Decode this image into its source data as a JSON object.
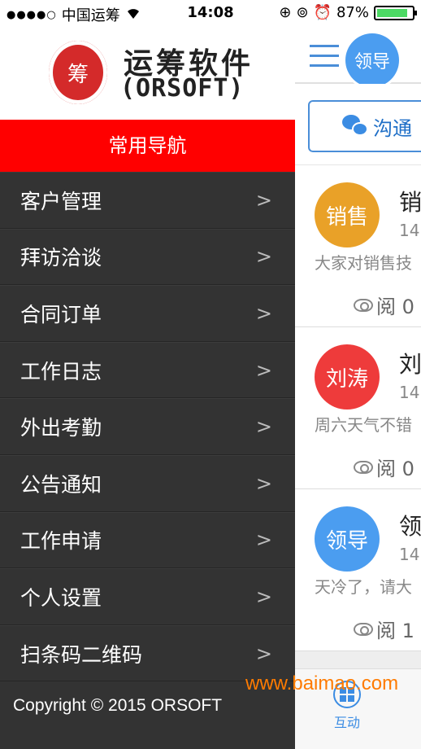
{
  "status_bar": {
    "signal": "●●●●○",
    "carrier": "中国运筹",
    "wifi_icon": "wifi-icon",
    "time": "14:08",
    "battery_percent": "87%",
    "battery_level": 0.87
  },
  "brand": {
    "seal_text": "筹",
    "name": "运筹软件",
    "sub": "(ORSOFT)"
  },
  "menu": {
    "header": "常用导航",
    "items": [
      {
        "label": "客户管理",
        "chevron": ">"
      },
      {
        "label": "拜访洽谈",
        "chevron": ">"
      },
      {
        "label": "合同订单",
        "chevron": ">"
      },
      {
        "label": "工作日志",
        "chevron": ">"
      },
      {
        "label": "外出考勤",
        "chevron": ">"
      },
      {
        "label": "公告通知",
        "chevron": ">"
      },
      {
        "label": "工作申请",
        "chevron": ">"
      },
      {
        "label": "个人设置",
        "chevron": ">"
      },
      {
        "label": "扫条码二维码",
        "chevron": ">"
      }
    ],
    "copyright": "Copyright © 2015 ORSOFT"
  },
  "content": {
    "top_avatar": "领导",
    "tab_label": "沟通",
    "posts": [
      {
        "avatar": "销售",
        "color": "#e9a128",
        "name": "销",
        "time": "14",
        "text": "大家对销售技",
        "read": "阅 0"
      },
      {
        "avatar": "刘涛",
        "color": "#ee3b3b",
        "name": "刘",
        "time": "14",
        "text": "周六天气不错",
        "read": "阅 0"
      },
      {
        "avatar": "领导",
        "color": "#4b9df0",
        "name": "领",
        "time": "14",
        "text": "天冷了，请大",
        "read": "阅 1"
      }
    ],
    "bottom_tab": "互动"
  },
  "watermark": "www.baimao.com"
}
